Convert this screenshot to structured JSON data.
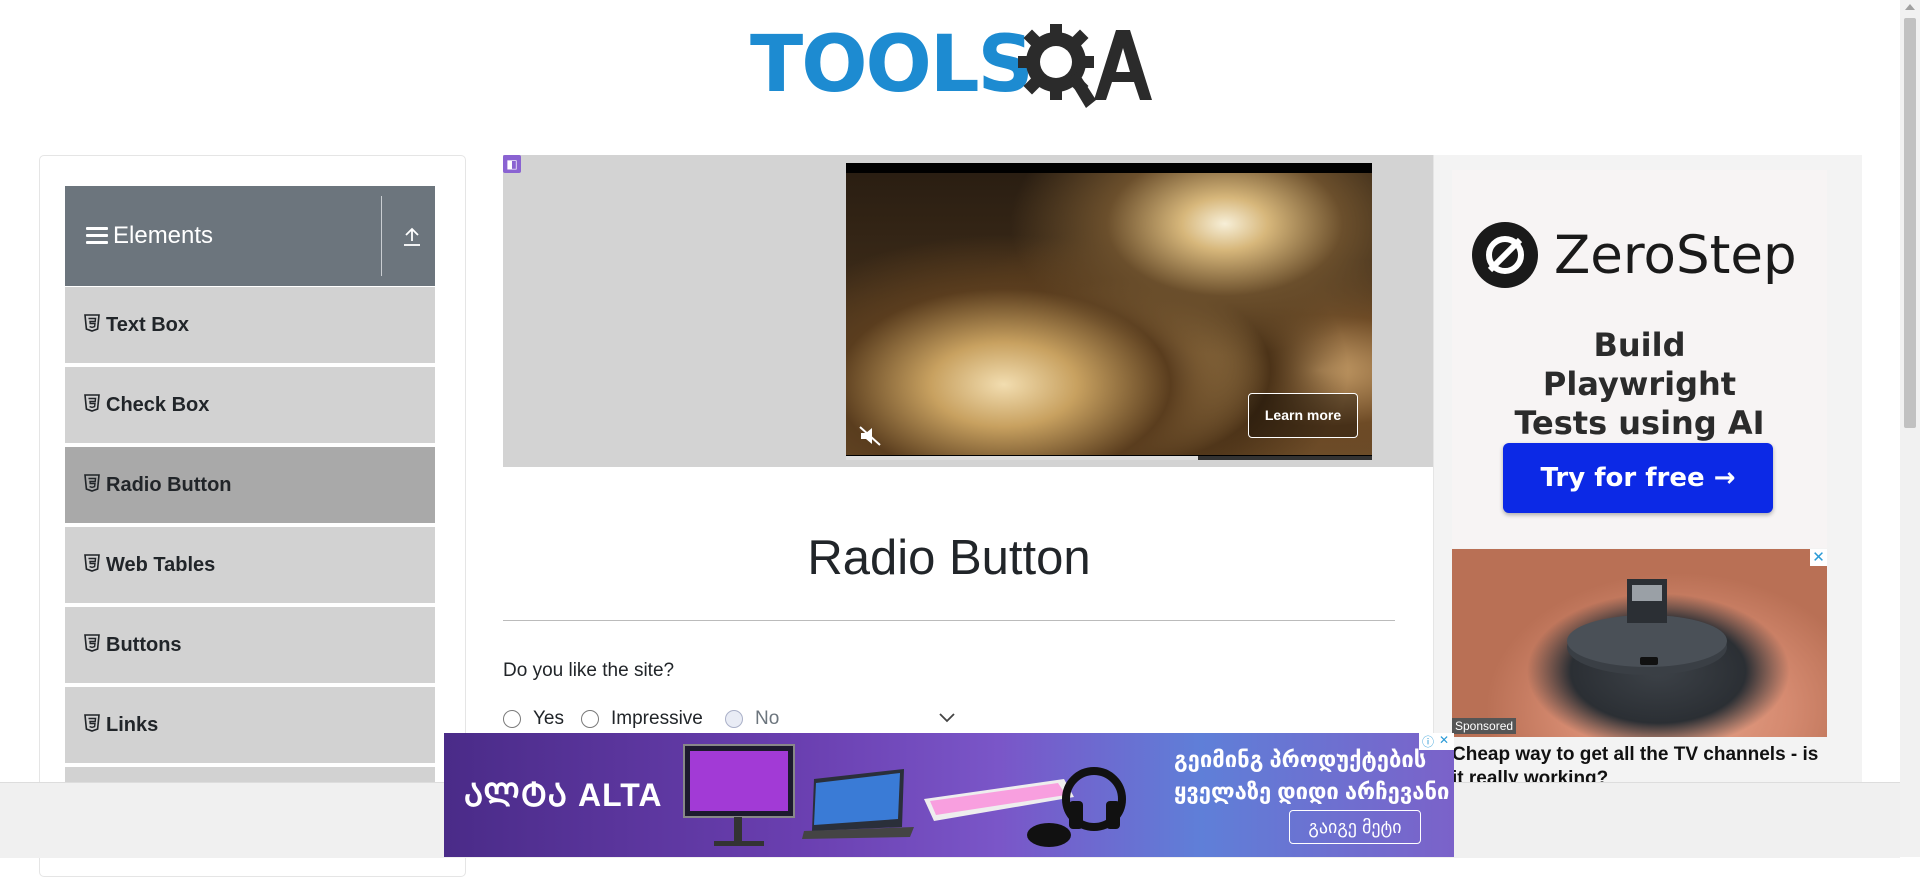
{
  "header": {
    "logo_text": "TOOLSQA"
  },
  "sidebar": {
    "group_title": "Elements",
    "items": [
      {
        "label": "Text Box"
      },
      {
        "label": "Check Box"
      },
      {
        "label": "Radio Button",
        "active": true
      },
      {
        "label": "Web Tables"
      },
      {
        "label": "Buttons"
      },
      {
        "label": "Links"
      }
    ]
  },
  "video_ad": {
    "cta": "Learn more",
    "progress": 0.67
  },
  "main": {
    "title": "Radio Button",
    "question": "Do you like the site?",
    "options": [
      {
        "label": "Yes",
        "disabled": false
      },
      {
        "label": "Impressive",
        "disabled": false
      },
      {
        "label": "No",
        "disabled": true
      }
    ]
  },
  "right_ad": {
    "brand": "ZeroStep",
    "tagline": "Build Playwright Tests using AI",
    "cta": "Try for free →",
    "sponsored_label": "Sponsored",
    "headline": "Cheap way to get all the TV channels - is it really working?"
  },
  "bottom_ad": {
    "brand": "ᲐᲚᲢᲐ ALTA",
    "line1": "გეიმინგ პროდუქტების",
    "line2": "ყველაზე დიდი არჩევანი",
    "cta": "გაიგე მეტი"
  },
  "colors": {
    "accent": "#1d8bd1",
    "sidebar_header": "#6c757d",
    "menu_item": "#d2d2d2",
    "menu_active": "#a9a9a9",
    "zerostep_button": "#0c29e6"
  }
}
